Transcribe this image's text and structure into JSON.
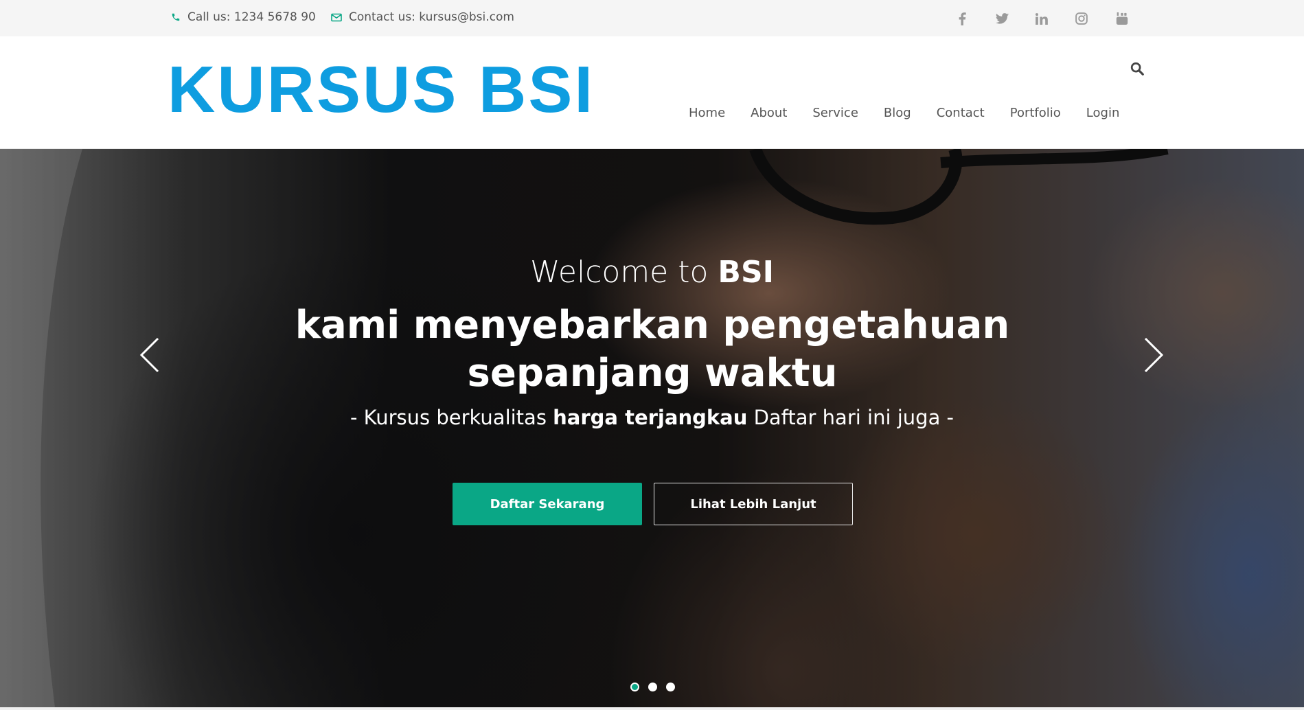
{
  "topbar": {
    "phone_text": "Call us: 1234 5678 90",
    "email_text": "Contact us: kursus@bsi.com",
    "social_icons": [
      "facebook-icon",
      "twitter-icon",
      "linkedin-icon",
      "instagram-icon",
      "youtube-icon"
    ]
  },
  "header": {
    "logo": "KURSUS BSI",
    "nav": [
      "Home",
      "About",
      "Service",
      "Blog",
      "Contact",
      "Portfolio",
      "Login"
    ]
  },
  "hero": {
    "welcome_prefix": "Welcome to ",
    "welcome_brand": "BSI",
    "title": "kami menyebarkan pengetahuan sepanjang waktu",
    "sub_prefix": "- Kursus berkualitas ",
    "sub_bold": "harga terjangkau",
    "sub_suffix": " Daftar hari ini juga -",
    "primary_button": "Daftar Sekarang",
    "secondary_button": "Lihat Lebih Lanjut",
    "slides": 3,
    "active_slide": 1
  },
  "colors": {
    "brand_blue": "#0e9de0",
    "accent_green": "#0aa786",
    "topbar_bg": "#f5f5f5",
    "nav_text": "#555555"
  }
}
